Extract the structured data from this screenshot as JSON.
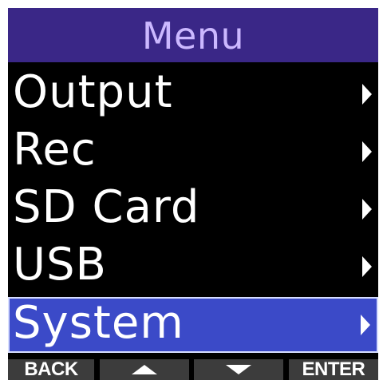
{
  "header": {
    "title": "Menu"
  },
  "menu": {
    "items": [
      {
        "label": "Output",
        "selected": false,
        "icon": "chevron-right-icon"
      },
      {
        "label": "Rec",
        "selected": false,
        "icon": "chevron-right-icon"
      },
      {
        "label": "SD Card",
        "selected": false,
        "icon": "chevron-right-icon"
      },
      {
        "label": "USB",
        "selected": false,
        "icon": "chevron-right-icon"
      },
      {
        "label": "System",
        "selected": true,
        "icon": "chevron-right-icon"
      }
    ]
  },
  "softkeys": {
    "back_label": "BACK",
    "up_icon": "up-arrow-icon",
    "down_icon": "down-arrow-icon",
    "enter_label": "ENTER"
  },
  "colors": {
    "title_bar": "#3a2787",
    "title_text": "#cbb8ff",
    "selection": "#3b4ac8",
    "softkey_bg": "#3c3c3c",
    "screen_bg": "#000000"
  }
}
